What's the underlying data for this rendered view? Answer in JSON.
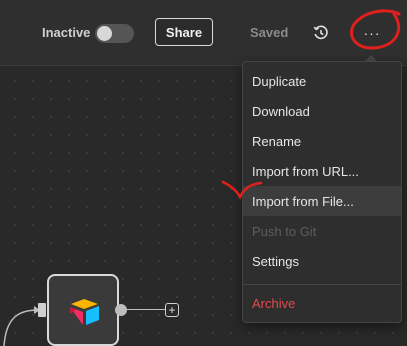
{
  "toolbar": {
    "status_label": "Inactive",
    "toggle_on": false,
    "share_label": "Share",
    "saved_label": "Saved",
    "history_icon": "history-icon",
    "more_label": "···"
  },
  "menu": {
    "items": [
      {
        "label": "Duplicate",
        "state": "normal"
      },
      {
        "label": "Download",
        "state": "normal"
      },
      {
        "label": "Rename",
        "state": "normal"
      },
      {
        "label": "Import from URL...",
        "state": "normal"
      },
      {
        "label": "Import from File...",
        "state": "highlighted"
      },
      {
        "label": "Push to Git",
        "state": "disabled"
      },
      {
        "label": "Settings",
        "state": "normal"
      },
      {
        "label": "Archive",
        "state": "danger"
      }
    ]
  },
  "canvas": {
    "node_icon": "airtable-icon",
    "add_label": "+"
  },
  "colors": {
    "danger": "#e5484d",
    "annotation": "#e0201d"
  }
}
